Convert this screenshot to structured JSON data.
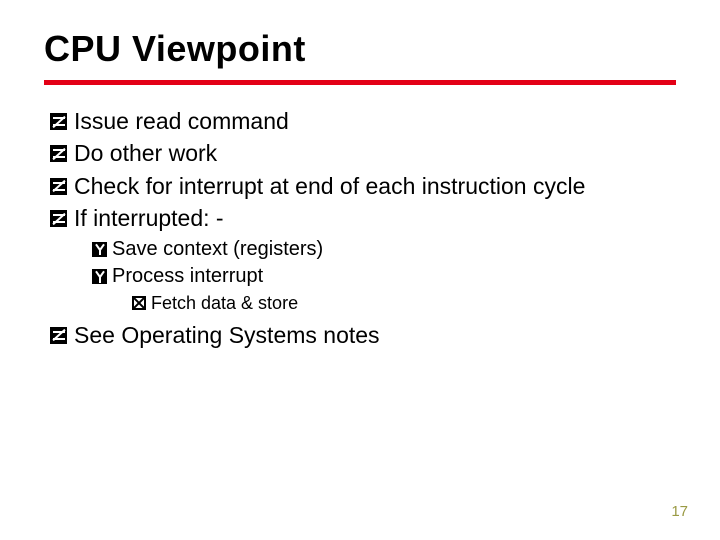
{
  "title": "CPU Viewpoint",
  "bullets": {
    "l1": [
      "Issue read command",
      "Do other work",
      "Check for interrupt at end of each instruction cycle",
      "If interrupted: -",
      "See Operating Systems notes"
    ],
    "l2": [
      "Save context (registers)",
      "Process interrupt"
    ],
    "l3": [
      "Fetch data & store"
    ]
  },
  "page_number": "17"
}
